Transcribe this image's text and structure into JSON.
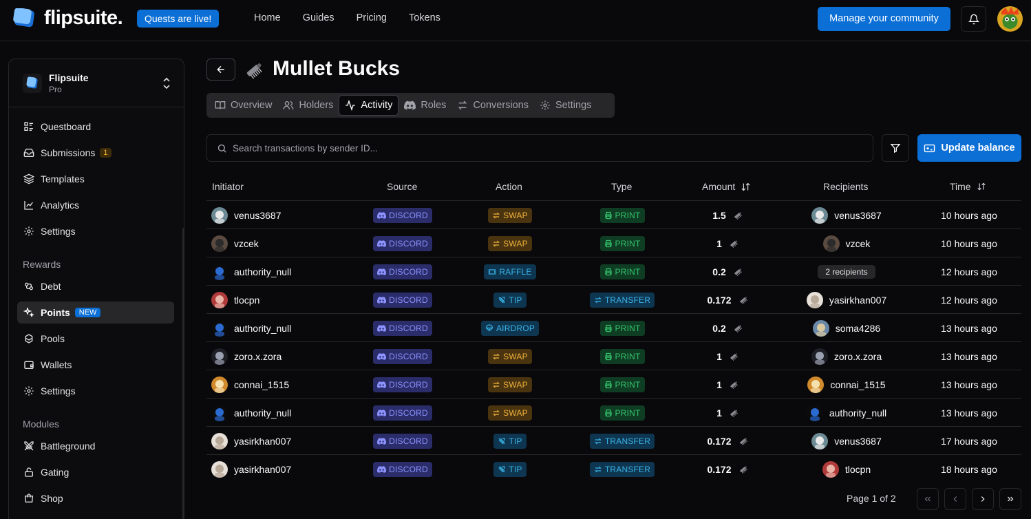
{
  "brand": {
    "name": "flipsuite.",
    "quest_badge": "Quests are live!"
  },
  "topnav": [
    "Home",
    "Guides",
    "Pricing",
    "Tokens"
  ],
  "manage_button": "Manage your community",
  "org": {
    "name": "Flipsuite",
    "plan": "Pro"
  },
  "sidebar": {
    "main": [
      {
        "label": "Questboard",
        "icon": "questboard-icon"
      },
      {
        "label": "Submissions",
        "icon": "inbox-icon",
        "count": "1"
      },
      {
        "label": "Templates",
        "icon": "layers-icon"
      },
      {
        "label": "Analytics",
        "icon": "chart-icon"
      },
      {
        "label": "Settings",
        "icon": "gear-icon"
      }
    ],
    "rewards_title": "Rewards",
    "rewards": [
      {
        "label": "Debt",
        "icon": "debt-icon"
      },
      {
        "label": "Points",
        "icon": "sparkles-icon",
        "badge": "NEW"
      },
      {
        "label": "Pools",
        "icon": "pools-icon"
      },
      {
        "label": "Wallets",
        "icon": "wallet-icon"
      },
      {
        "label": "Settings",
        "icon": "gear-icon"
      }
    ],
    "modules_title": "Modules",
    "modules": [
      {
        "label": "Battleground",
        "icon": "swords-icon"
      },
      {
        "label": "Gating",
        "icon": "lock-icon"
      },
      {
        "label": "Shop",
        "icon": "shop-icon"
      }
    ]
  },
  "page": {
    "title": "Mullet Bucks"
  },
  "tabs": [
    "Overview",
    "Holders",
    "Activity",
    "Roles",
    "Conversions",
    "Settings"
  ],
  "search": {
    "placeholder": "Search transactions by sender ID..."
  },
  "update_button": "Update balance",
  "table": {
    "headers": [
      "Initiator",
      "Source",
      "Action",
      "Type",
      "Amount",
      "Recipients",
      "Time"
    ],
    "rows": [
      {
        "initiator": "venus3687",
        "source": "DISCORD",
        "action": "SWAP",
        "type": "PRINT",
        "amount": "1.5",
        "recipient": "venus3687",
        "time": "10 hours ago"
      },
      {
        "initiator": "vzcek",
        "source": "DISCORD",
        "action": "SWAP",
        "type": "PRINT",
        "amount": "1",
        "recipient": "vzcek",
        "time": "10 hours ago"
      },
      {
        "initiator": "authority_null",
        "source": "DISCORD",
        "action": "RAFFLE",
        "type": "PRINT",
        "amount": "0.2",
        "recipient": "2 recipients",
        "time": "12 hours ago"
      },
      {
        "initiator": "tlocpn",
        "source": "DISCORD",
        "action": "TIP",
        "type": "TRANSFER",
        "amount": "0.172",
        "recipient": "yasirkhan007",
        "time": "12 hours ago"
      },
      {
        "initiator": "authority_null",
        "source": "DISCORD",
        "action": "AIRDROP",
        "type": "PRINT",
        "amount": "0.2",
        "recipient": "soma4286",
        "time": "13 hours ago"
      },
      {
        "initiator": "zoro.x.zora",
        "source": "DISCORD",
        "action": "SWAP",
        "type": "PRINT",
        "amount": "1",
        "recipient": "zoro.x.zora",
        "time": "13 hours ago"
      },
      {
        "initiator": "connai_1515",
        "source": "DISCORD",
        "action": "SWAP",
        "type": "PRINT",
        "amount": "1",
        "recipient": "connai_1515",
        "time": "13 hours ago"
      },
      {
        "initiator": "authority_null",
        "source": "DISCORD",
        "action": "SWAP",
        "type": "PRINT",
        "amount": "1",
        "recipient": "authority_null",
        "time": "13 hours ago"
      },
      {
        "initiator": "yasirkhan007",
        "source": "DISCORD",
        "action": "TIP",
        "type": "TRANSFER",
        "amount": "0.172",
        "recipient": "venus3687",
        "time": "17 hours ago"
      },
      {
        "initiator": "yasirkhan007",
        "source": "DISCORD",
        "action": "TIP",
        "type": "TRANSFER",
        "amount": "0.172",
        "recipient": "tlocpn",
        "time": "18 hours ago"
      }
    ]
  },
  "pagination": {
    "text": "Page 1 of 2"
  },
  "colors": {
    "accent": "#0b6fd6",
    "background": "#09090b",
    "border": "#27272a"
  }
}
